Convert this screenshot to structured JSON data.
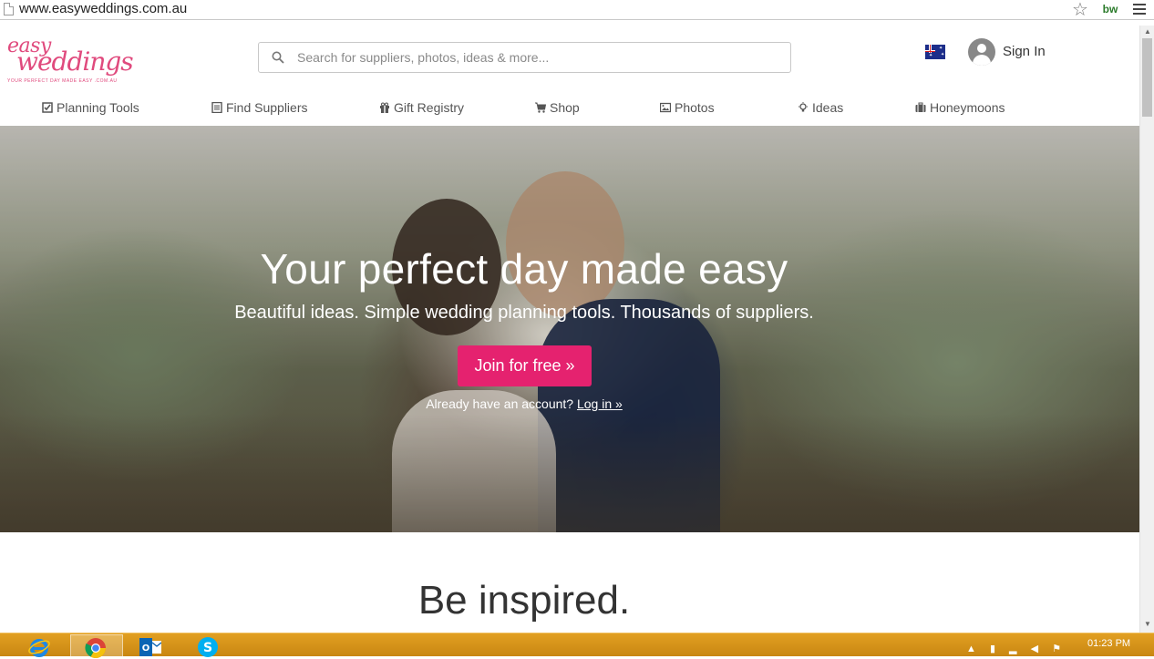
{
  "browser": {
    "url": "www.easyweddings.com.au",
    "star_icon": "star-icon",
    "extension_label": "bw",
    "menu_icon": "hamburger-menu-icon"
  },
  "header": {
    "logo": {
      "line1": "easy",
      "line2": "weddings",
      "tagline": "YOUR PERFECT DAY MADE EASY .COM.AU"
    },
    "search_placeholder": "Search for suppliers, photos, ideas & more...",
    "country_flag": "australia-flag",
    "sign_in_label": "Sign In"
  },
  "nav": [
    {
      "label": "Planning Tools",
      "icon": "checkbox-icon"
    },
    {
      "label": "Find Suppliers",
      "icon": "list-icon"
    },
    {
      "label": "Gift Registry",
      "icon": "gift-icon"
    },
    {
      "label": "Shop",
      "icon": "cart-icon"
    },
    {
      "label": "Photos",
      "icon": "image-icon"
    },
    {
      "label": "Ideas",
      "icon": "lightbulb-icon"
    },
    {
      "label": "Honeymoons",
      "icon": "suitcase-icon"
    }
  ],
  "hero": {
    "title": "Your perfect day made easy",
    "subtitle": "Beautiful ideas. Simple wedding planning tools. Thousands of suppliers.",
    "cta_label": "Join for free »",
    "login_prompt": "Already have an account?",
    "login_link": "Log in »"
  },
  "section": {
    "heading": "Be inspired."
  },
  "colors": {
    "accent": "#e5226f",
    "logo": "#e04a7d",
    "taskbar": "#d8941a"
  },
  "taskbar": {
    "apps": [
      "internet-explorer-icon",
      "chrome-icon",
      "outlook-icon",
      "skype-icon"
    ],
    "clock": "01:23 PM"
  }
}
